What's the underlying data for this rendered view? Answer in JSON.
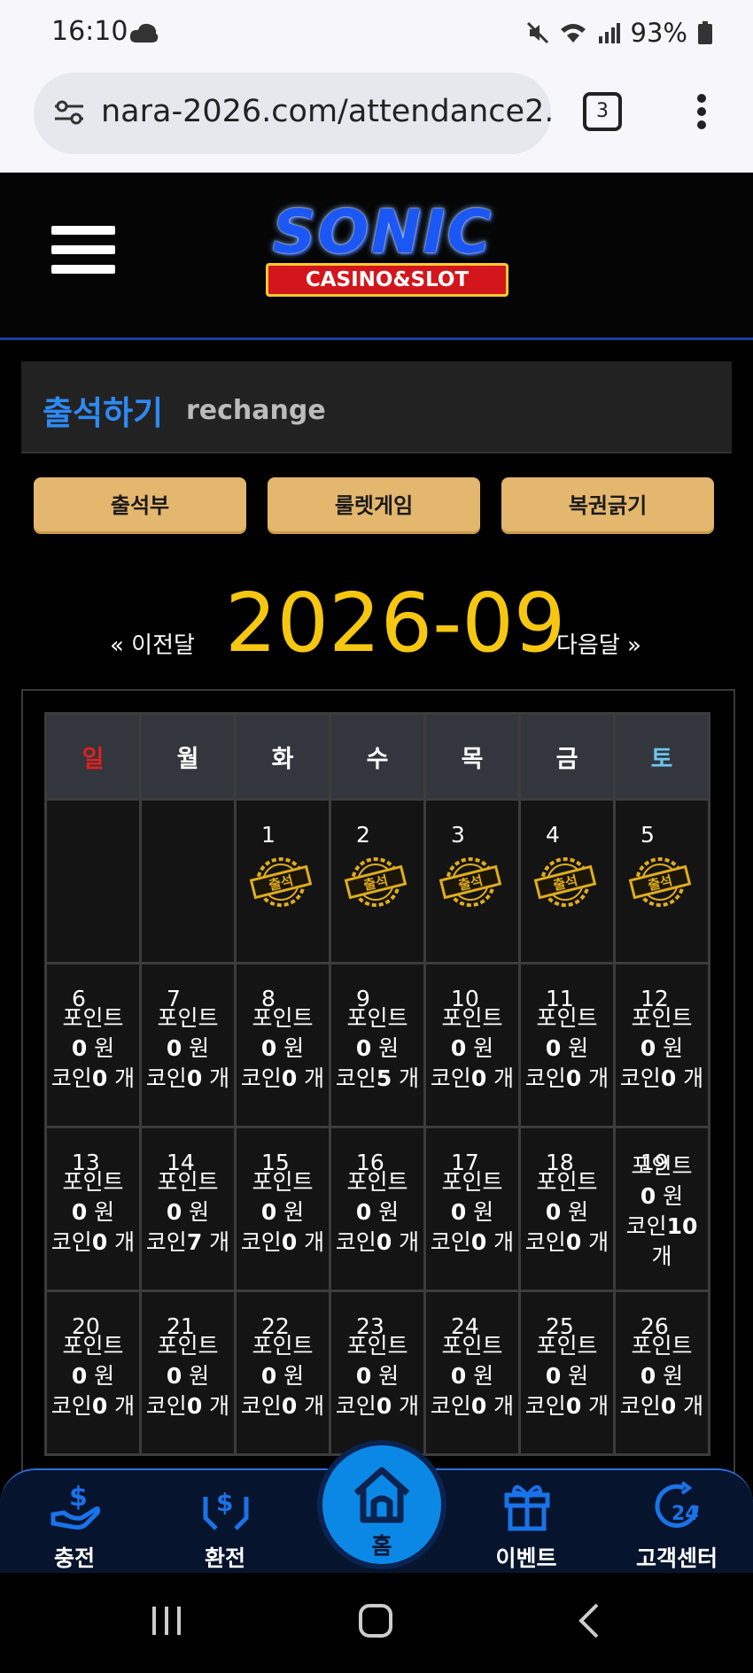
{
  "status": {
    "time": "16:10",
    "battery": "93%"
  },
  "browser": {
    "url": "nara-2026.com/attendance2.",
    "tab_count": "3"
  },
  "header": {
    "logo_main": "SONIC",
    "logo_sub": "CASINO&SLOT"
  },
  "panel": {
    "title": "출석하기",
    "subtitle": "rechange"
  },
  "buttons": {
    "attendance": "출석부",
    "roulette": "룰렛게임",
    "lottery": "복권긁기"
  },
  "calendar": {
    "prev": "« 이전달",
    "month": "2026-09",
    "next": "다음달 »",
    "weekdays": [
      "일",
      "월",
      "화",
      "수",
      "목",
      "금",
      "토"
    ],
    "stamp_text": "출석",
    "point_label": "포인트",
    "won_unit": "원",
    "coin_label": "코인",
    "coin_unit": "개",
    "week1": [
      "1",
      "2",
      "3",
      "4",
      "5"
    ],
    "week2": [
      {
        "day": "6",
        "points": "0",
        "coins": "0"
      },
      {
        "day": "7",
        "points": "0",
        "coins": "0"
      },
      {
        "day": "8",
        "points": "0",
        "coins": "0"
      },
      {
        "day": "9",
        "points": "0",
        "coins": "5"
      },
      {
        "day": "10",
        "points": "0",
        "coins": "0"
      },
      {
        "day": "11",
        "points": "0",
        "coins": "0"
      },
      {
        "day": "12",
        "points": "0",
        "coins": "0"
      }
    ],
    "week3": [
      {
        "day": "13",
        "points": "0",
        "coins": "0"
      },
      {
        "day": "14",
        "points": "0",
        "coins": "7"
      },
      {
        "day": "15",
        "points": "0",
        "coins": "0"
      },
      {
        "day": "16",
        "points": "0",
        "coins": "0"
      },
      {
        "day": "17",
        "points": "0",
        "coins": "0"
      },
      {
        "day": "18",
        "points": "0",
        "coins": "0"
      },
      {
        "day": "19",
        "points": "0",
        "coins": "10"
      }
    ],
    "week4": [
      {
        "day": "20",
        "points": "0",
        "coins": "0"
      },
      {
        "day": "21",
        "points": "0",
        "coins": "0"
      },
      {
        "day": "22",
        "points": "0",
        "coins": "0"
      },
      {
        "day": "23",
        "points": "0",
        "coins": "0"
      },
      {
        "day": "24",
        "points": "0",
        "coins": "0"
      },
      {
        "day": "25",
        "points": "0",
        "coins": "0"
      },
      {
        "day": "26",
        "points": "0",
        "coins": "0"
      }
    ]
  },
  "bottom_nav": {
    "charge": "충전",
    "exchange": "환전",
    "home": "홈",
    "event": "이벤트",
    "support": "고객센터"
  },
  "colors": {
    "accent_blue": "#2e8af4",
    "gold": "#f5c711",
    "button": "#e4b76e",
    "sunday": "#e02020",
    "saturday": "#6cc7f2"
  },
  "icons": [
    "cloud-icon",
    "mute-icon",
    "wifi-icon",
    "signal-icon",
    "battery-icon",
    "tune-icon",
    "tabs-icon",
    "kebab-menu-icon",
    "hamburger-icon",
    "stamp-icon",
    "charge-icon",
    "exchange-icon",
    "home-icon",
    "gift-icon",
    "support-24-icon",
    "recents-icon",
    "home-circle-icon",
    "back-icon"
  ]
}
